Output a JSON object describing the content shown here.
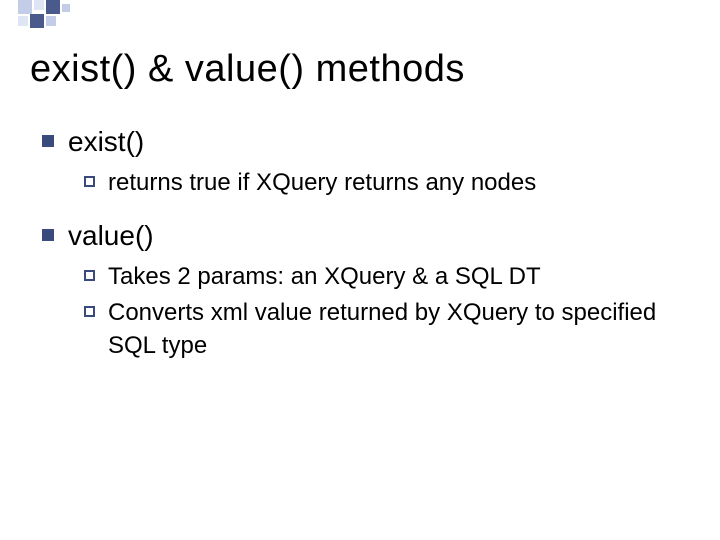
{
  "title": "exist() & value()  methods",
  "items": [
    {
      "label": "exist()",
      "sub": [
        {
          "text": "returns true if XQuery returns any nodes"
        }
      ]
    },
    {
      "label": "value()",
      "sub": [
        {
          "text": "Takes 2 params: an XQuery & a SQL DT"
        },
        {
          "text": "Converts xml value returned by XQuery to specified SQL type"
        }
      ]
    }
  ]
}
